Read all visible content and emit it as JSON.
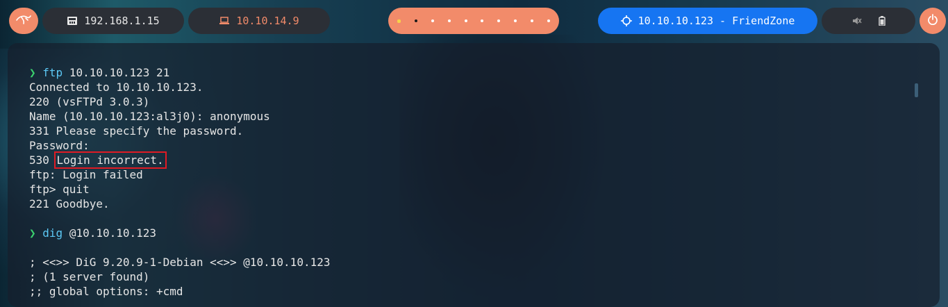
{
  "topbar": {
    "local_ip": "192.168.1.15",
    "vpn_ip": "10.10.14.9",
    "workspace_count": 10,
    "workspace_active_index": 1,
    "target_label": "10.10.10.123 - FriendZone",
    "colors": {
      "accent": "#f28b6a",
      "target": "#1675f2",
      "pill_dark": "#2b2f36"
    },
    "icons": {
      "logo": "kali-dragon-icon",
      "local": "network-icon",
      "vpn": "laptop-icon",
      "target": "crosshair-icon",
      "mute": "volume-mute-icon",
      "battery": "battery-icon",
      "power": "power-icon"
    }
  },
  "terminal": {
    "prompt_symbol": "❯",
    "blocks": {
      "ftp_cmd": "ftp",
      "ftp_args": " 10.10.10.123 21",
      "l1": "Connected to 10.10.10.123.",
      "l2": "220 (vsFTPd 3.0.3)",
      "l3": "Name (10.10.10.123:al3j0): anonymous",
      "l4": "331 Please specify the password.",
      "l5": "Password:",
      "l6_code": "530 ",
      "l6_msg": "Login incorrect.",
      "l7": "ftp: Login failed",
      "l8": "ftp> quit",
      "l9": "221 Goodbye.",
      "dig_cmd": "dig",
      "dig_args": " @10.10.10.123",
      "d1": "; <<>> DiG 9.20.9-1-Debian <<>> @10.10.10.123",
      "d2": "; (1 server found)",
      "d3": ";; global options: +cmd"
    }
  }
}
